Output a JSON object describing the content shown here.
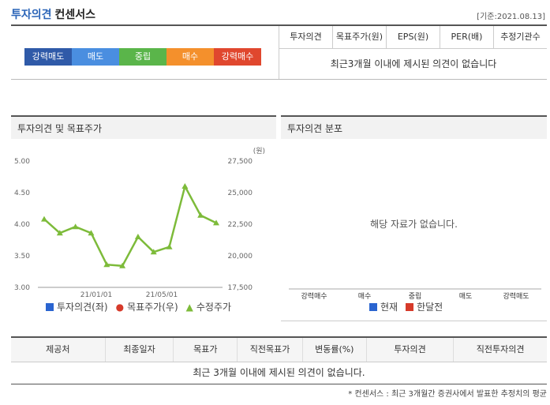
{
  "header": {
    "title_a": "투자의견",
    "title_b": "컨센서스",
    "asof": "[기준:2021.08.13]"
  },
  "scale": [
    {
      "label": "강력매도",
      "color": "#2f5aa8"
    },
    {
      "label": "매도",
      "color": "#4a8ee0"
    },
    {
      "label": "중립",
      "color": "#5ab54a"
    },
    {
      "label": "매수",
      "color": "#f4902c"
    },
    {
      "label": "강력매수",
      "color": "#e0472e"
    }
  ],
  "consensus": {
    "headers": [
      "투자의견",
      "목표주가(원)",
      "EPS(원)",
      "PER(배)",
      "추정기관수"
    ],
    "message": "최근3개월 이내에 제시된 의견이 없습니다"
  },
  "panel_left": {
    "title": "투자의견 및 목표주가",
    "legend": [
      "투자의견(좌)",
      "목표주가(우)",
      "수정주가"
    ]
  },
  "panel_right": {
    "title": "투자의견 분포",
    "no_data": "해당 자료가 없습니다.",
    "categories": [
      "강력매수",
      "매수",
      "중립",
      "매도",
      "강력매도"
    ],
    "legend": [
      "현재",
      "한달전"
    ]
  },
  "chart_data": {
    "type": "line",
    "y_left": {
      "ticks": [
        "5.00",
        "4.50",
        "4.00",
        "3.50",
        "3.00"
      ],
      "range": [
        3.0,
        5.0
      ]
    },
    "y_right": {
      "ticks": [
        "27,500",
        "25,000",
        "22,500",
        "20,000",
        "17,500"
      ],
      "range": [
        17500,
        27500
      ],
      "unit": "(원)"
    },
    "x_ticks": [
      "21/01/01",
      "21/05/01"
    ],
    "series": [
      {
        "name": "수정주가",
        "color": "#7dbb3a",
        "values": [
          22900,
          21800,
          22300,
          21800,
          19300,
          19200,
          21500,
          20300,
          20700,
          25500,
          23200,
          22600
        ]
      }
    ]
  },
  "bottom": {
    "headers": [
      "제공처",
      "최종일자",
      "목표가",
      "직전목표가",
      "변동률(%)",
      "투자의견",
      "직전투자의견"
    ],
    "message": "최근 3개월 이내에 제시된 의견이 없습니다.",
    "note": "* 컨센서스 : 최근 3개월간 증권사에서 발표한 추정치의 평균"
  }
}
